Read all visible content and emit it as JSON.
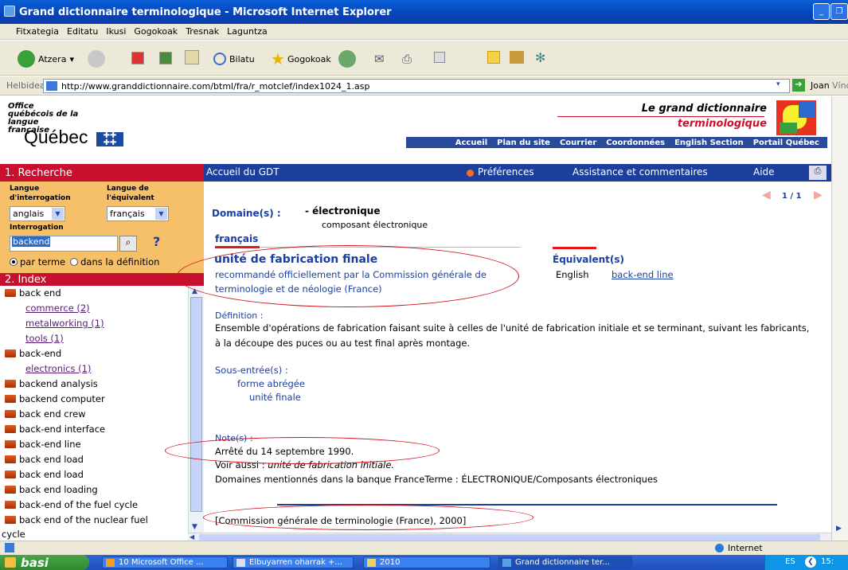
{
  "window": {
    "title": "Grand dictionnaire terminologique - Microsoft Internet Explorer"
  },
  "menu": [
    "Fitxategia",
    "Editatu",
    "Ikusi",
    "Gogokoak",
    "Tresnak",
    "Laguntza"
  ],
  "toolbar": {
    "back": "Atzera",
    "search": "Bilatu",
    "favorites": "Gogokoak"
  },
  "address": {
    "label": "Helbidea",
    "url": "http://www.granddictionnaire.com/btml/fra/r_motclef/index1024_1.asp",
    "go": "Joan",
    "links": "Vínculos"
  },
  "header": {
    "office": "Office québécois de la langue française",
    "quebec": "Québec",
    "gdt_line1": "Le grand dictionnaire",
    "gdt_line2": "terminologique",
    "nav": [
      "Accueil",
      "Plan du site",
      "Courrier",
      "Coordonnées",
      "English Section",
      "Portail Québec"
    ]
  },
  "sidebar": {
    "search_title": "1. Recherche",
    "lang_query_label": "Langue d'interrogation",
    "lang_equiv_label": "Langue de l'équivalent",
    "lang_query_value": "anglais",
    "lang_equiv_value": "français",
    "query_label": "Interrogation",
    "query_value": "backend",
    "help": "?",
    "radio_term": "par terme",
    "radio_def": "dans la définition",
    "index_title": "2. Index",
    "index": [
      {
        "label": "back end",
        "type": "folder"
      },
      {
        "label": "commerce (2)",
        "type": "link"
      },
      {
        "label": "metalworking (1)",
        "type": "link"
      },
      {
        "label": "tools (1)",
        "type": "link"
      },
      {
        "label": "back-end",
        "type": "folder"
      },
      {
        "label": "electronics (1)",
        "type": "link"
      },
      {
        "label": "backend analysis",
        "type": "folder"
      },
      {
        "label": "backend computer",
        "type": "folder"
      },
      {
        "label": "back end crew",
        "type": "folder"
      },
      {
        "label": "back-end interface",
        "type": "folder"
      },
      {
        "label": "back-end line",
        "type": "folder"
      },
      {
        "label": "back end load",
        "type": "folder"
      },
      {
        "label": "back end load",
        "type": "folder"
      },
      {
        "label": "back end loading",
        "type": "folder"
      },
      {
        "label": "back-end of the fuel cycle",
        "type": "folder"
      },
      {
        "label": "back end of the nuclear fuel",
        "type": "folder"
      },
      {
        "label": "cycle",
        "type": "text"
      }
    ]
  },
  "contentnav": {
    "home": "Accueil du GDT",
    "prefs": "Préférences",
    "assist": "Assistance et commentaires",
    "help": "Aide",
    "pager": "1 / 1"
  },
  "record": {
    "domain_label": "Domaine(s) :",
    "domain_value": "- électronique",
    "domain_sub": "composant électronique",
    "lang": "français",
    "term": "unité de fabrication finale",
    "term_note_1": "recommandé officiellement par la Commission générale de",
    "term_note_2": "terminologie et de néologie (France)",
    "equiv_label": "Équivalent(s)",
    "equiv_lang": "English",
    "equiv_term": "back-end line",
    "def_label": "Définition :",
    "def_1": "Ensemble d'opérations de fabrication faisant suite à celles de l'unité de fabrication initiale et se terminant, suivant les fabricants,",
    "def_2": "à la découpe des puces ou au test final après montage.",
    "sub_label": "Sous-entrée(s) :",
    "sub_1": "forme abrégée",
    "sub_2": "unité finale",
    "note_label": "Note(s) :",
    "note_1": "Arrêté du 14 septembre 1990.",
    "note_2a": "Voir aussi : ",
    "note_2b": "unité de fabrication initiale.",
    "note_3": "Domaines mentionnés dans la banque FranceTerme : ÉLECTRONIQUE/Composants électroniques",
    "source": "[Commission générale de terminologie (France), 2000]"
  },
  "status": {
    "zone": "Internet"
  },
  "taskbar": {
    "start": "basi",
    "tasks": [
      "10 Microsoft Office ...",
      "Elbuyarren oharrak +...",
      "2010",
      "Grand dictionnaire ter..."
    ],
    "lang": "ES",
    "clock": "15:"
  }
}
